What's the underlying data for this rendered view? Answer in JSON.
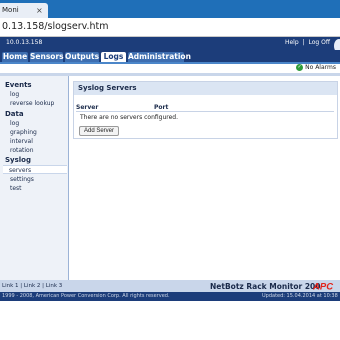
{
  "browser": {
    "tab_title": "Moni",
    "tab_close": "×",
    "address": "0.13.158/slogserv.htm"
  },
  "header": {
    "ip_address": "10.0.13.158",
    "help_label": "Help",
    "logoff_label": "Log Off",
    "separator": "|"
  },
  "nav": {
    "tabs": [
      {
        "label": "Home"
      },
      {
        "label": "Sensors"
      },
      {
        "label": "Outputs"
      },
      {
        "label": "Logs"
      },
      {
        "label": "Administration"
      }
    ],
    "active_tab": "Logs"
  },
  "status": {
    "alarms_label": "No Alarms",
    "alarm_icon": "check-circle-icon",
    "alarm_color": "#2e9b3a"
  },
  "sidebar": {
    "sections": [
      {
        "heading": "Events",
        "items": [
          "log",
          "reverse lookup"
        ]
      },
      {
        "heading": "Data",
        "items": [
          "log",
          "graphing",
          "interval",
          "rotation"
        ]
      },
      {
        "heading": "Syslog",
        "items": [
          "servers",
          "settings",
          "test"
        ]
      }
    ],
    "selected": "servers"
  },
  "main": {
    "panel_title": "Syslog Servers",
    "columns": [
      "Server",
      "Port"
    ],
    "empty_message": "There are no servers configured.",
    "add_button": "Add Server"
  },
  "footer": {
    "links": [
      "Link 1",
      "Link 2",
      "Link 3"
    ],
    "link_separator": "|",
    "product_name": "NetBotz Rack Monitor 200",
    "brand": "APC",
    "copyright": "1999 - 2008, American Power Conversion Corp. All rights reserved.",
    "updated": "Updated: 15.04.2014 at 10:38",
    "brand_color": "#e2231a"
  }
}
